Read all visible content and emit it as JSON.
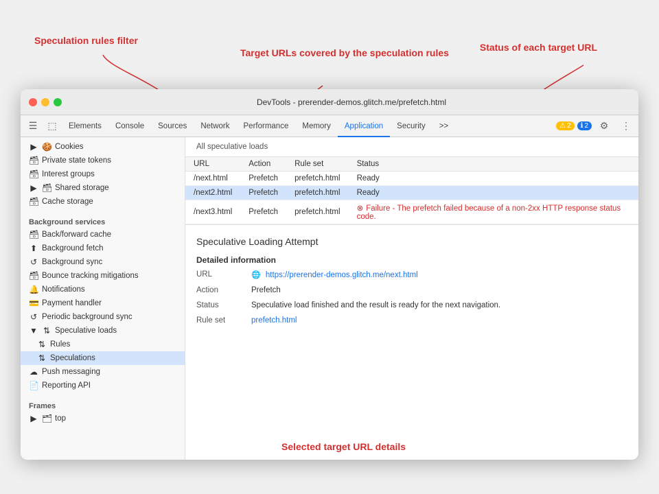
{
  "annotations": {
    "speculation_rules_filter": "Speculation rules filter",
    "target_urls": "Target URLs covered by\nthe speculation rules",
    "status_label": "Status of each target URL",
    "selected_details": "Selected target URL details"
  },
  "browser": {
    "title": "DevTools - prerender-demos.glitch.me/prefetch.html"
  },
  "devtools_tabs": {
    "tabs": [
      "Elements",
      "Console",
      "Sources",
      "Network",
      "Performance",
      "Memory",
      "Application",
      "Security",
      ">>"
    ],
    "active": "Application",
    "icons_left": [
      "≡",
      "□"
    ],
    "warn_count": "2",
    "info_count": "2"
  },
  "sidebar": {
    "sections": [
      {
        "items": [
          {
            "label": "Cookies",
            "icon": "▶ 🍪",
            "indent": 0
          },
          {
            "label": "Private state tokens",
            "icon": "🗃",
            "indent": 0
          },
          {
            "label": "Interest groups",
            "icon": "🗃",
            "indent": 0
          },
          {
            "label": "Shared storage",
            "icon": "▶ 🗃",
            "indent": 0
          },
          {
            "label": "Cache storage",
            "icon": "🗃",
            "indent": 0
          }
        ]
      },
      {
        "header": "Background services",
        "items": [
          {
            "label": "Back/forward cache",
            "icon": "🗃",
            "indent": 0
          },
          {
            "label": "Background fetch",
            "icon": "⬆",
            "indent": 0
          },
          {
            "label": "Background sync",
            "icon": "↺",
            "indent": 0
          },
          {
            "label": "Bounce tracking mitigations",
            "icon": "🗃",
            "indent": 0
          },
          {
            "label": "Notifications",
            "icon": "🔔",
            "indent": 0
          },
          {
            "label": "Payment handler",
            "icon": "💳",
            "indent": 0
          },
          {
            "label": "Periodic background sync",
            "icon": "↺",
            "indent": 0
          },
          {
            "label": "Speculative loads",
            "icon": "▼ ↑↓",
            "indent": 0,
            "expanded": true
          },
          {
            "label": "Rules",
            "icon": "↑↓",
            "indent": 1
          },
          {
            "label": "Speculations",
            "icon": "↑↓",
            "indent": 1,
            "active": true
          },
          {
            "label": "Push messaging",
            "icon": "☁",
            "indent": 0
          },
          {
            "label": "Reporting API",
            "icon": "📄",
            "indent": 0
          }
        ]
      },
      {
        "header": "Frames",
        "items": [
          {
            "label": "top",
            "icon": "▶ 🗂",
            "indent": 0
          }
        ]
      }
    ]
  },
  "table": {
    "section_label": "All speculative loads",
    "columns": [
      "URL",
      "Action",
      "Rule set",
      "Status"
    ],
    "rows": [
      {
        "url": "/next.html",
        "action": "Prefetch",
        "rule_set": "prefetch.html",
        "status": "Ready",
        "type": "ready",
        "selected": false
      },
      {
        "url": "/next2.html",
        "action": "Prefetch",
        "rule_set": "prefetch.html",
        "status": "Ready",
        "type": "ready",
        "selected": true
      },
      {
        "url": "/next3.html",
        "action": "Prefetch",
        "rule_set": "prefetch.html",
        "status": "Failure - The prefetch failed because of a non-2xx HTTP response status code.",
        "type": "error",
        "selected": false
      }
    ]
  },
  "detail": {
    "title": "Speculative Loading Attempt",
    "section": "Detailed information",
    "rows": [
      {
        "label": "URL",
        "value": "https://prerender-demos.glitch.me/next.html",
        "type": "link"
      },
      {
        "label": "Action",
        "value": "Prefetch",
        "type": "text"
      },
      {
        "label": "Status",
        "value": "Speculative load finished and the result is ready for the next navigation.",
        "type": "text"
      },
      {
        "label": "Rule set",
        "value": "prefetch.html",
        "type": "link"
      }
    ]
  }
}
